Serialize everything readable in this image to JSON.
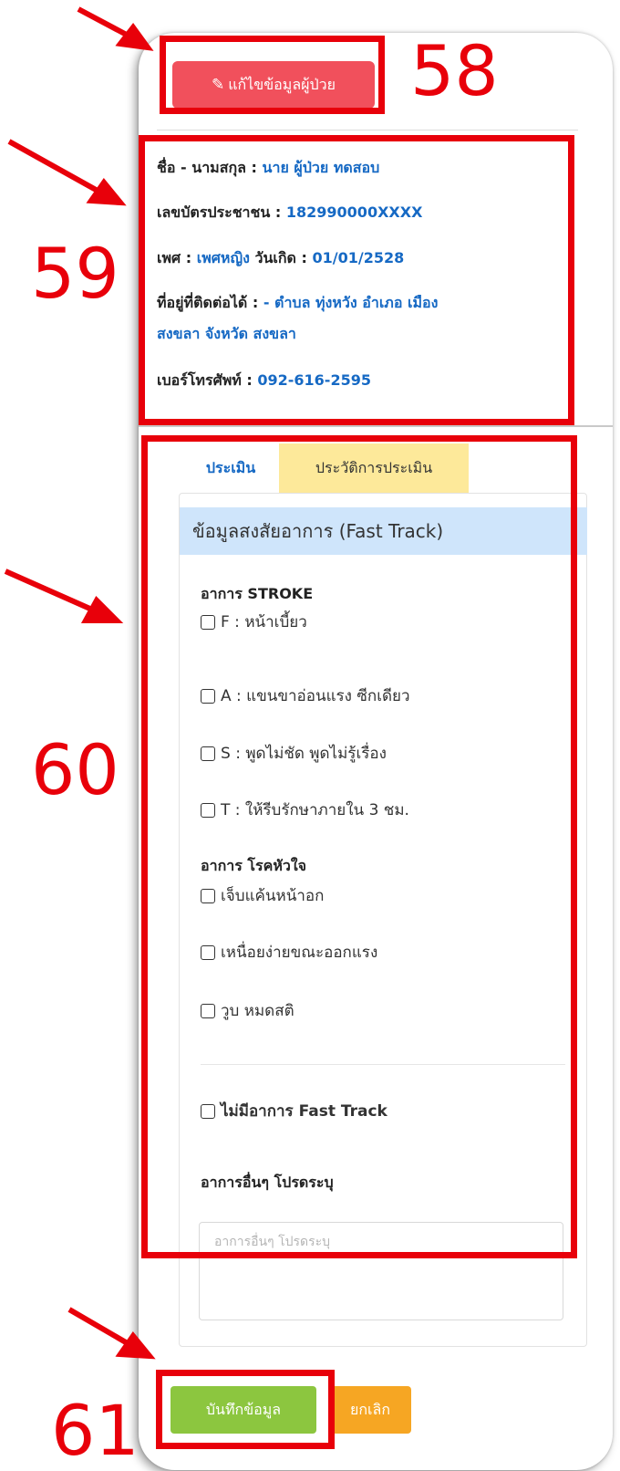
{
  "edit_button": {
    "icon": "pencil-icon",
    "label": "แก้ไขข้อมูลผู้ป่วย"
  },
  "patient": {
    "name_label": "ชื่อ - นามสกุล : ",
    "name_value": "นาย ผู้ป่วย ทดสอบ",
    "id_label": "เลขบัตรประชาชน : ",
    "id_value": "182990000XXXX",
    "gender_label": "เพศ : ",
    "gender_value": "เพศหญิง",
    "dob_label": " วันเกิด : ",
    "dob_value": "01/01/2528",
    "address_label": "ที่อยู่ที่ติดต่อได้ : ",
    "address_line1": "- ตำบล ทุ่งหวัง อำเภอ เมือง",
    "address_line2": "สงขลา จังหวัด สงขลา",
    "phone_label": "เบอร์โทรศัพท์ : ",
    "phone_value": "092-616-2595"
  },
  "tabs": [
    {
      "label": "ประเมิน",
      "active": true
    },
    {
      "label": "ประวัติการประเมิน",
      "active": false
    }
  ],
  "section_title": "ข้อมูลสงสัยอาการ (Fast Track)",
  "stroke": {
    "title": "อาการ STROKE",
    "items": [
      "F : หน้าเบี้ยว",
      "A : แขนขาอ่อนแรง ซีกเดียว",
      "S : พูดไม่ชัด พูดไม่รู้เรื่อง",
      "T : ให้รีบรักษาภายใน 3 ชม."
    ]
  },
  "heart": {
    "title": "อาการ โรคหัวใจ",
    "items": [
      "เจ็บแค้นหน้าอก",
      "เหนื่อยง่ายขณะออกแรง",
      "วูบ หมดสติ"
    ]
  },
  "no_fast_track": "ไม่มีอาการ Fast Track",
  "other": {
    "title": "อาการอื่นๆ โปรดระบุ",
    "placeholder": "อาการอื่นๆ โปรดระบุ"
  },
  "buttons": {
    "save": "บันทึกข้อมูล",
    "cancel": "ยกเลิก"
  },
  "callouts": [
    "58",
    "59",
    "60",
    "61"
  ],
  "colors": {
    "annotation": "#e8000a",
    "edit_button": "#f1505c",
    "save_button": "#8cc63f",
    "cancel_button": "#f6a623",
    "value_text": "#1669c4",
    "section_header": "#cfe5fb",
    "history_tab": "#fde99a"
  }
}
